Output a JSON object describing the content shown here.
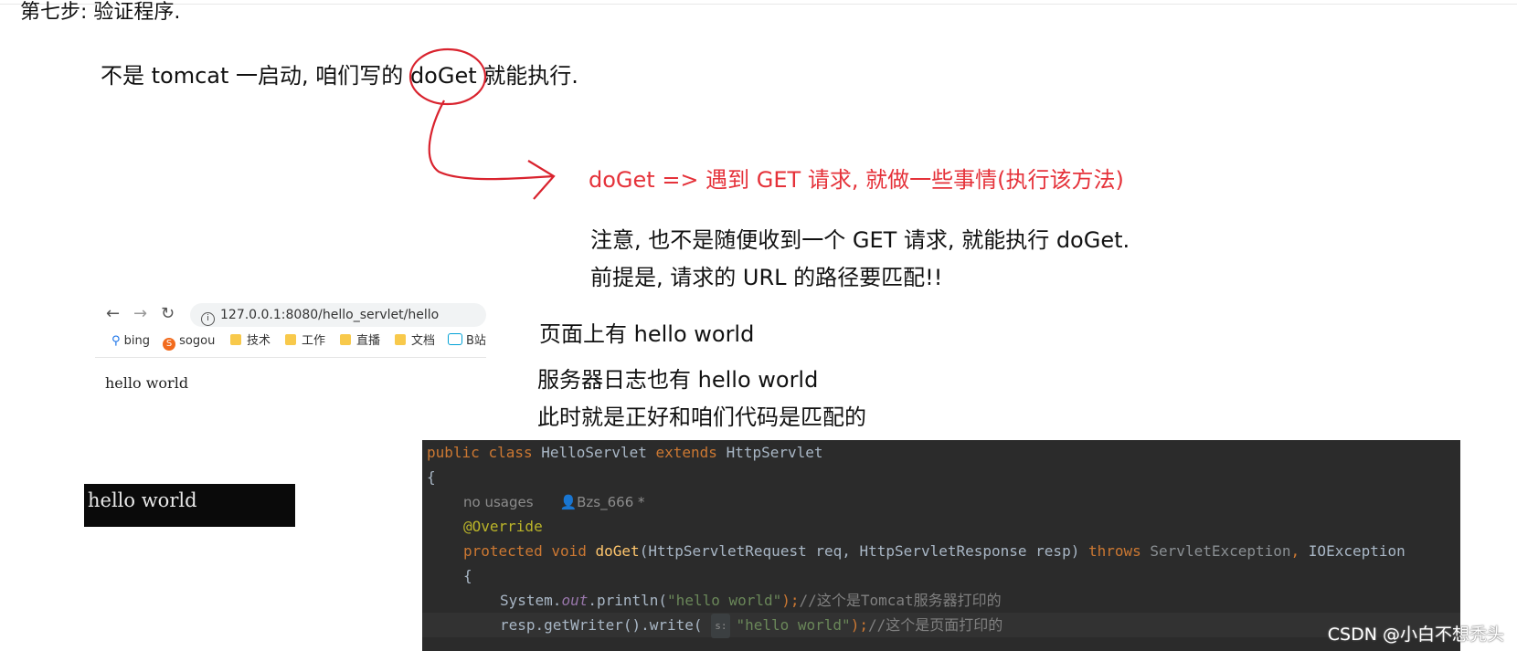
{
  "step_title": "第七步: 验证程序.",
  "intro": {
    "prefix": "不是 tomcat 一启动, 咱们写的 ",
    "circled": "doGet",
    "suffix": " 就能执行."
  },
  "doget_note": "doGet => 遇到 GET 请求, 就做一些事情(执行该方法)",
  "notes": [
    "注意, 也不是随便收到一个 GET 请求, 就能执行 doGet.",
    "前提是, 请求的 URL 的路径要匹配!!"
  ],
  "results": [
    "页面上有 hello world",
    "服务器日志也有 hello world",
    "此时就是正好和咱们代码是匹配的"
  ],
  "browser": {
    "url": "127.0.0.1:8080/hello_servlet/hello",
    "bookmarks": [
      "bing",
      "sogou",
      "技术",
      "工作",
      "直播",
      "文档",
      "B站"
    ],
    "page_text": "hello world"
  },
  "console_output": "hello world",
  "code": {
    "line1": {
      "kw1": "public",
      "kw2": "class",
      "name": "HelloServlet",
      "kw3": "extends",
      "parent": "HttpServlet"
    },
    "brace_open": "{",
    "hint_usages": "no usages",
    "hint_author": "Bzs_666 *",
    "annotation": "@Override",
    "method": {
      "kw1": "protected",
      "kw2": "void",
      "name": "doGet",
      "params": "(HttpServletRequest req, HttpServletResponse resp) ",
      "throws": "throws",
      "ex1": "ServletException",
      "comma": ", ",
      "ex2": "IOException"
    },
    "inner_brace": "{",
    "println": {
      "pre": "System.",
      "field": "out",
      "call": ".println(",
      "str": "\"hello world\"",
      "end": ");",
      "comment": "//这个是Tomcat服务器打印的"
    },
    "write": {
      "pre": "resp.getWriter().write(",
      "chip": "s:",
      "str": "\"hello world\"",
      "end": ");",
      "comment": "//这个是页面打印的"
    }
  },
  "watermark": "CSDN @小白不想秃头",
  "colors": {
    "annotation_red": "#e5323a",
    "code_bg": "#2b2b2b",
    "keyword": "#cc7832"
  }
}
